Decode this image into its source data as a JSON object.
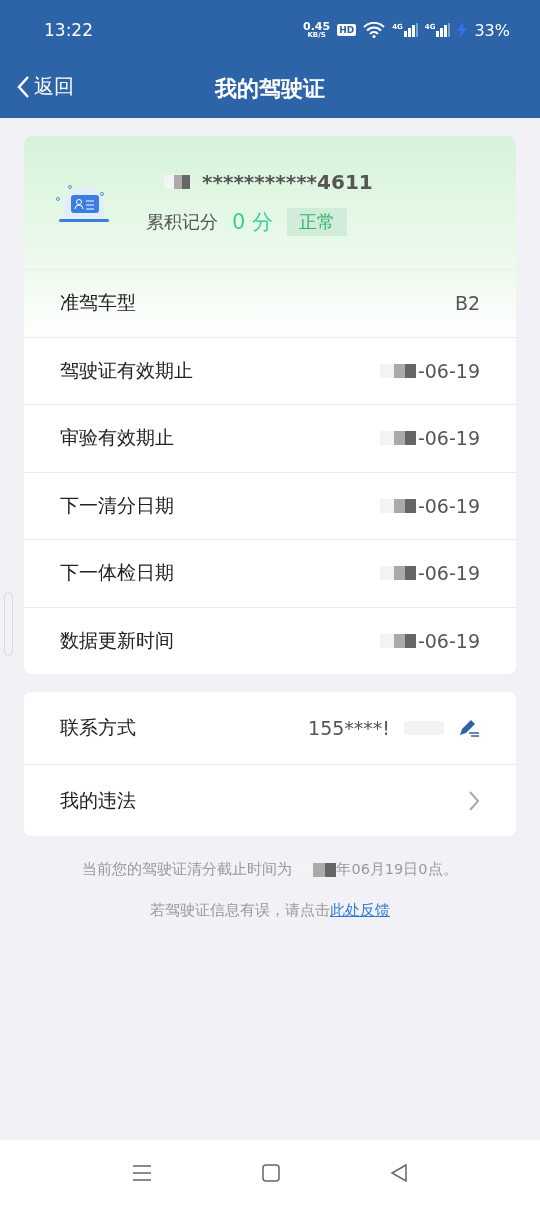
{
  "status_bar": {
    "time": "13:22",
    "net_speed": "0.45",
    "net_unit": "KB/S",
    "hd_badge": "HD",
    "signals": [
      {
        "label": "4G"
      },
      {
        "label": "4G"
      }
    ],
    "battery": "33%",
    "charging": true
  },
  "header": {
    "back": "返回",
    "title": "我的驾驶证"
  },
  "license": {
    "number": "***********4611",
    "points_label": "累积记分",
    "points": "0 分",
    "status": "正常"
  },
  "details": [
    {
      "label": "准驾车型",
      "value": "B2",
      "redacted": false
    },
    {
      "label": "驾驶证有效期止",
      "value": "-06-19",
      "redacted": true
    },
    {
      "label": "审验有效期止",
      "value": "-06-19",
      "redacted": true
    },
    {
      "label": "下一清分日期",
      "value": "-06-19",
      "redacted": true
    },
    {
      "label": "下一体检日期",
      "value": "-06-19",
      "redacted": true
    },
    {
      "label": "数据更新时间",
      "value": "-06-19",
      "redacted": true
    }
  ],
  "actions": [
    {
      "kind": "edit",
      "label": "联系方式",
      "value": "155****!"
    },
    {
      "kind": "link",
      "label": "我的违法"
    }
  ],
  "notes": [
    {
      "before": "当前您的驾驶证清分截止时间为",
      "after": "年06月19日0点。"
    },
    {
      "before": "若驾驶证信息有误，请点击",
      "link": "此处反馈"
    }
  ]
}
